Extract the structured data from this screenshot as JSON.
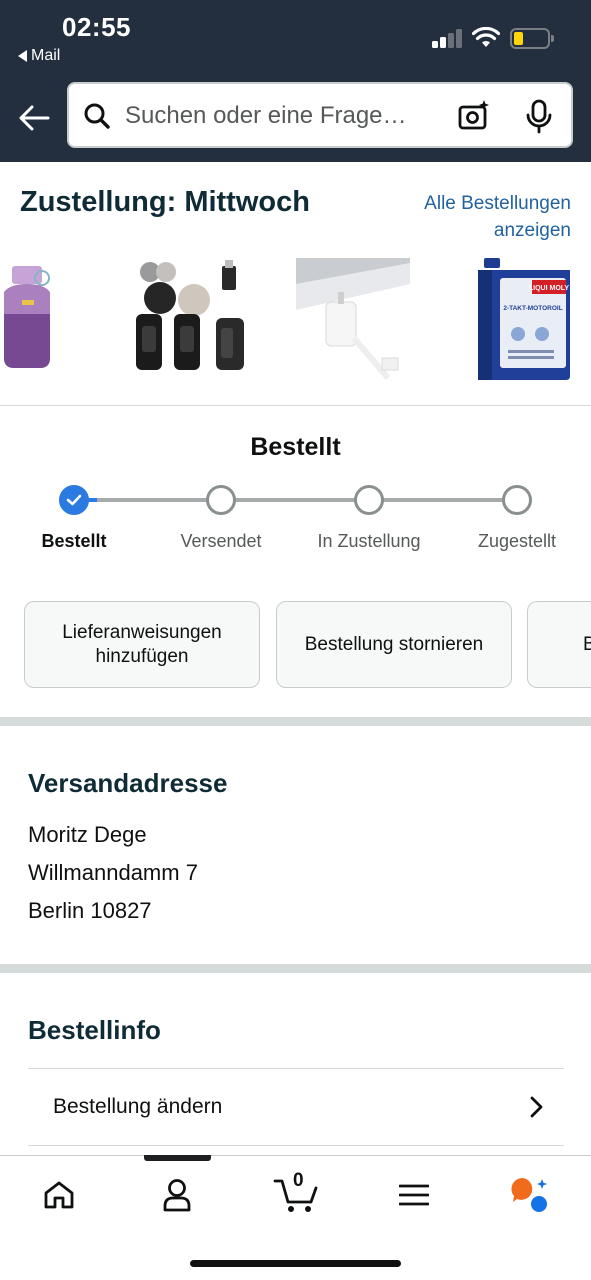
{
  "status_bar": {
    "time": "02:55",
    "back_app": "Mail",
    "signal_icon": "cellular-signal-icon",
    "wifi_icon": "wifi-icon",
    "battery_icon": "battery-low-icon",
    "battery_color": "#ffd60a"
  },
  "header": {
    "background": "#232f3e",
    "search_placeholder": "Suchen oder eine Frage…",
    "back_icon": "arrow-left-icon",
    "search_icon": "search-icon",
    "camera_icon": "camera-sparkle-icon",
    "mic_icon": "microphone-icon"
  },
  "delivery": {
    "title": "Zustellung: Mittwoch",
    "all_orders_link": "Alle Bestellungen anzeigen",
    "products": [
      {
        "name": "water-bottle-product"
      },
      {
        "name": "wireless-microphone-product"
      },
      {
        "name": "usb-c-adapter-product"
      },
      {
        "name": "motor-oil-product",
        "brand_text": "LIQUI MOLY",
        "label_text": "2-TAKT-MOTOROIL"
      }
    ]
  },
  "tracker": {
    "heading": "Bestellt",
    "accent_color": "#2a7ae2",
    "steps": [
      {
        "label": "Bestellt",
        "active": true
      },
      {
        "label": "Versendet",
        "active": false
      },
      {
        "label": "In Zustellung",
        "active": false
      },
      {
        "label": "Zugestellt",
        "active": false
      }
    ]
  },
  "actions": {
    "add_instructions": "Lieferanweisungen hinzufügen",
    "cancel_order": "Bestellung stornieren",
    "third_partial": "B"
  },
  "shipping": {
    "title": "Versandadresse",
    "name": "Moritz Dege",
    "street": "Willmanndamm 7",
    "city": "Berlin 10827"
  },
  "order_info": {
    "title": "Bestellinfo",
    "modify_order": "Bestellung ändern"
  },
  "bottom_nav": {
    "items": [
      "home-icon",
      "account-icon",
      "cart-icon",
      "menu-icon",
      "ai-assistant-icon"
    ],
    "cart_count": "0"
  }
}
